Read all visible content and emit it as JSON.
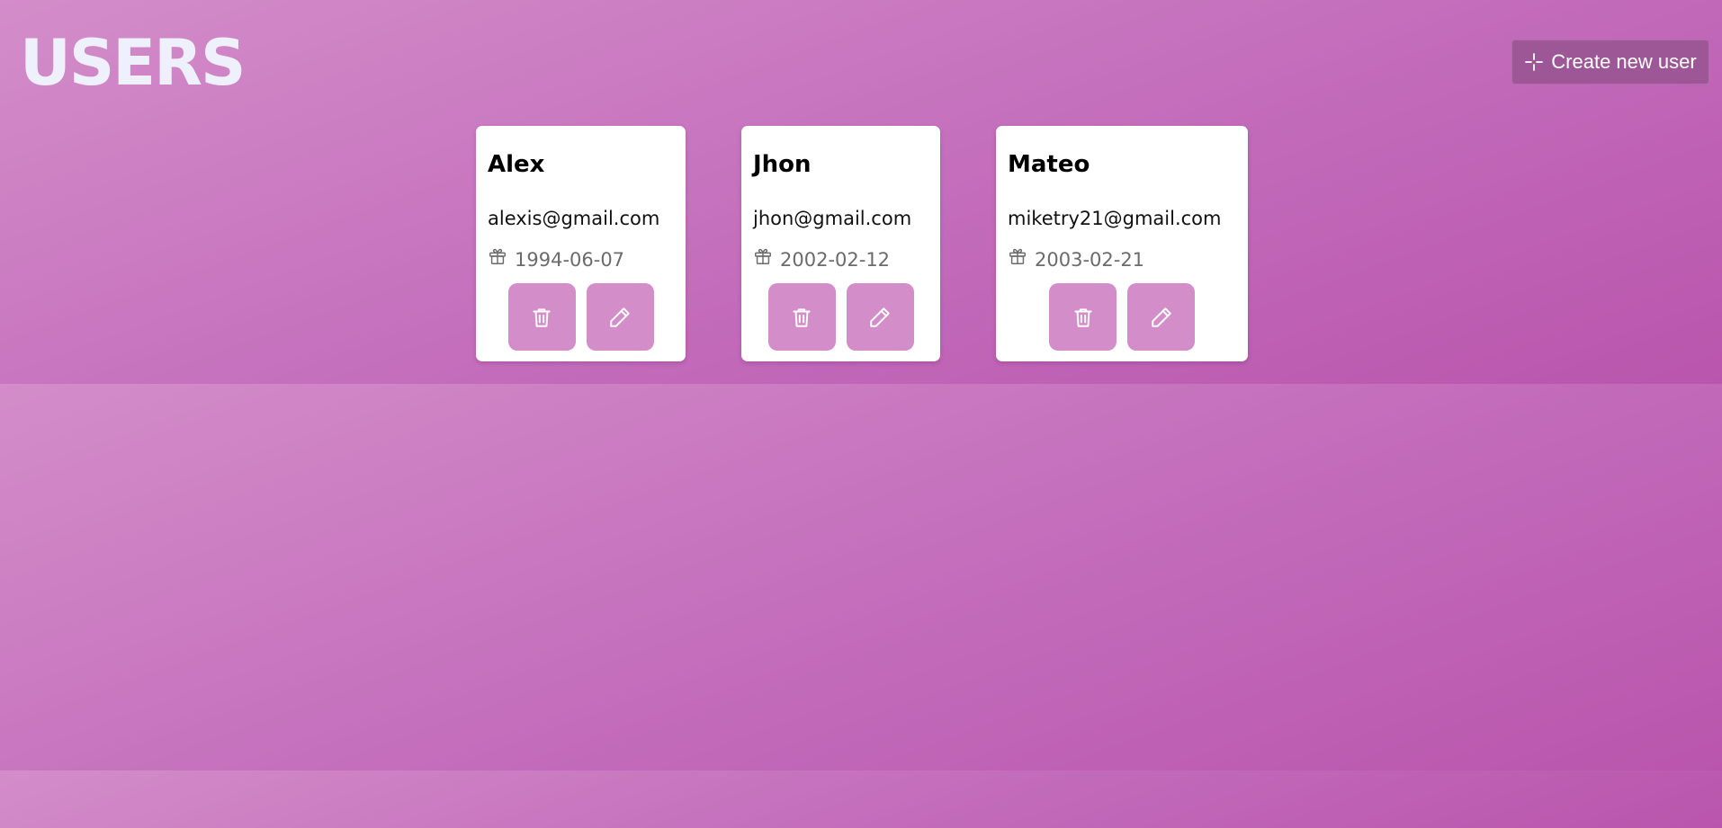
{
  "header": {
    "title": "USERS",
    "create_button": {
      "label": "Create new user",
      "icon": "sparkle-icon"
    }
  },
  "users": [
    {
      "name": "Alex",
      "email": "alexis@gmail.com",
      "birthday": "1994-06-07"
    },
    {
      "name": "Jhon",
      "email": "jhon@gmail.com",
      "birthday": "2002-02-12"
    },
    {
      "name": "Mateo",
      "email": "miketry21@gmail.com",
      "birthday": "2003-02-21"
    }
  ],
  "icons": {
    "birthday": "gift-icon",
    "delete": "trash-icon",
    "edit": "pencil-icon"
  },
  "colors": {
    "background_start": "#d38dc9",
    "background_end": "#b955ad",
    "title": "#eef0fb",
    "action_button": "#d38dc9",
    "create_button": "#9d5797",
    "card": "#ffffff",
    "birthday_text": "#6b6b6b"
  }
}
